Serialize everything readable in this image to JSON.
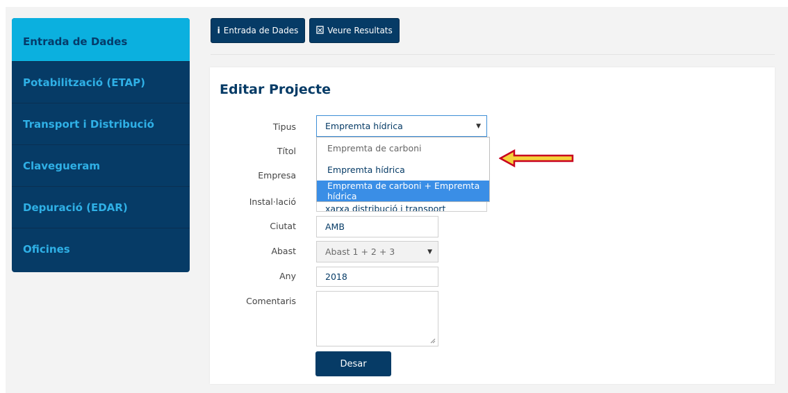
{
  "sidebar": {
    "items": [
      {
        "label": "Entrada de Dades",
        "active": true
      },
      {
        "label": "Potabilització (ETAP)"
      },
      {
        "label": "Transport i Distribució"
      },
      {
        "label": "Clavegueram"
      },
      {
        "label": "Depuració (EDAR)"
      },
      {
        "label": "Oficines"
      }
    ]
  },
  "toolbar": {
    "entrada_label": "Entrada de Dades",
    "entrada_icon": "i",
    "resultats_label": "Veure Resultats",
    "resultats_icon": "🗎"
  },
  "form": {
    "title": "Editar Projecte",
    "tipus": {
      "label": "Tipus",
      "value": "Empremta hídrica",
      "options": [
        "Empremta de carboni",
        "Empremta hídrica",
        "Empremta de carboni + Empremta hídrica"
      ],
      "highlighted": "Empremta de carboni + Empremta hídrica"
    },
    "titol": {
      "label": "Títol"
    },
    "empresa": {
      "label": "Empresa"
    },
    "installacio": {
      "label": "Instal·lació",
      "value": "xarxa distribució i transport"
    },
    "ciutat": {
      "label": "Ciutat",
      "value": "AMB"
    },
    "abast": {
      "label": "Abast",
      "value": "Abast 1 + 2 + 3"
    },
    "any": {
      "label": "Any",
      "value": "2018"
    },
    "comentaris": {
      "label": "Comentaris",
      "value": ""
    },
    "save_label": "Desar"
  },
  "colors": {
    "navy": "#063b66",
    "sidebar_active": "#0bb0df",
    "sidebar_text": "#2fb0e6",
    "highlight": "#3a8ee6",
    "arrow_fill": "#f5d23a",
    "arrow_stroke": "#c8001e"
  }
}
